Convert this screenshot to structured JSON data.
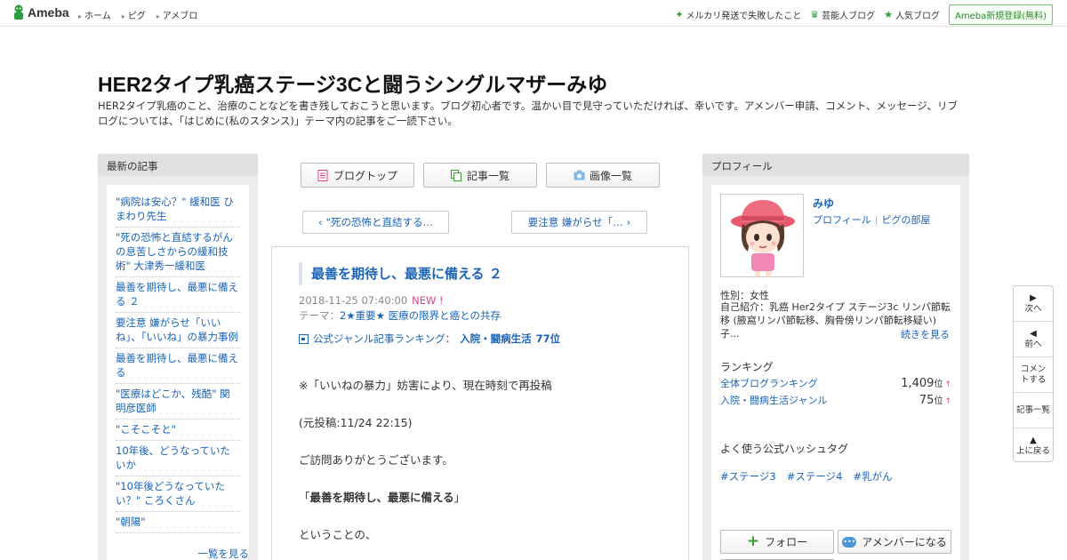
{
  "topbar": {
    "logo": "Ameba",
    "nav": [
      "ホーム",
      "ピグ",
      "アメブロ"
    ],
    "right": [
      {
        "label": "メルカリ発送で失敗したこと",
        "icon": "sparkle-icon"
      },
      {
        "label": "芸能人ブログ",
        "icon": "crown-icon"
      },
      {
        "label": "人気ブログ",
        "icon": "star-icon"
      }
    ],
    "register": "Ameba新規登録(無料)"
  },
  "blog": {
    "title": "HER2タイプ乳癌ステージ3Cと闘うシングルマザーみゆ",
    "description": "HER2タイプ乳癌のこと、治療のことなどを書き残しておこうと思います。ブログ初心者です。温かい目で見守っていただければ、幸いです。アメンバー申請、コメント、メッセージ、リブログについては、「はじめに(私のスタンス)」テーマ内の記事をご一読下さい。"
  },
  "left": {
    "heading": "最新の記事",
    "items": [
      "\"病院は安心？\" 緩和医 ひまわり先生",
      "\"死の恐怖と直結するがんの息苦しさからの緩和技術\" 大津秀一緩和医",
      "最善を期待し、最悪に備える ２",
      "要注意 嫌がらせ「いいね」、「いいね」の暴力事例",
      "最善を期待し、最悪に備える",
      "\"医療はどこか、残酷\" 関明彦医師",
      "\"こそこそと\"",
      "10年後、どうなっていたいか",
      "\"10年後どうなっていたい？\" ころくさん",
      "\"朝陽\""
    ],
    "more": "一覧を見る"
  },
  "tabs": [
    {
      "label": "ブログトップ",
      "icon": "document-icon"
    },
    {
      "label": "記事一覧",
      "icon": "copy-icon"
    },
    {
      "label": "画像一覧",
      "icon": "camera-icon"
    }
  ],
  "pager": {
    "prev": "\"死の恐怖と直結する…",
    "next": "要注意 嫌がらせ「…"
  },
  "article": {
    "title": "最善を期待し、最悪に備える ２",
    "date": "2018-11-25 07:40:00",
    "new_badge": "NEW !",
    "theme_label": "テーマ：",
    "theme": "2★重要★ 医療の限界と癌との共存",
    "genre_label": "公式ジャンル記事ランキング：",
    "genre": "入院・闘病生活",
    "genre_rank": "77位",
    "paragraphs": [
      "※「いいねの暴力」妨害により、現在時刻で再投稿",
      "(元投稿:11/24 22:15)",
      "ご訪問ありがとうございます。",
      "最善を期待し、最悪に備える",
      "ということの、"
    ]
  },
  "right": {
    "heading": "プロフィール",
    "name": "みゆ",
    "link_profile": "プロフィール",
    "link_pig": "ピグの部屋",
    "gender": "性別：女性",
    "intro": "自己紹介：乳癌 Her2タイプ ステージ3c リンパ節転移 (腋窩リンパ節転移、胸骨傍リンパ節転移疑い) 子...",
    "more": "続きを見る",
    "ranking_head": "ランキング",
    "rankings": [
      {
        "label": "全体ブログランキング",
        "value": "1,409",
        "unit": "位",
        "arrow": "↑"
      },
      {
        "label": "入院・闘病生活ジャンル",
        "value": "75",
        "unit": "位",
        "arrow": "↑"
      }
    ],
    "tags_head": "よく使う公式ハッシュタグ",
    "tags": [
      "#ステージ3",
      "#ステージ4",
      "#乳がん"
    ],
    "follow": "フォロー",
    "amember": "アメンバーになる"
  },
  "floatnav": [
    {
      "arrow": "▶",
      "label": "次へ"
    },
    {
      "arrow": "◀",
      "label": "前へ"
    },
    {
      "arrow": "",
      "label": "コメントする"
    },
    {
      "arrow": "",
      "label": "記事一覧"
    },
    {
      "arrow": "▲",
      "label": "上に戻る"
    }
  ]
}
